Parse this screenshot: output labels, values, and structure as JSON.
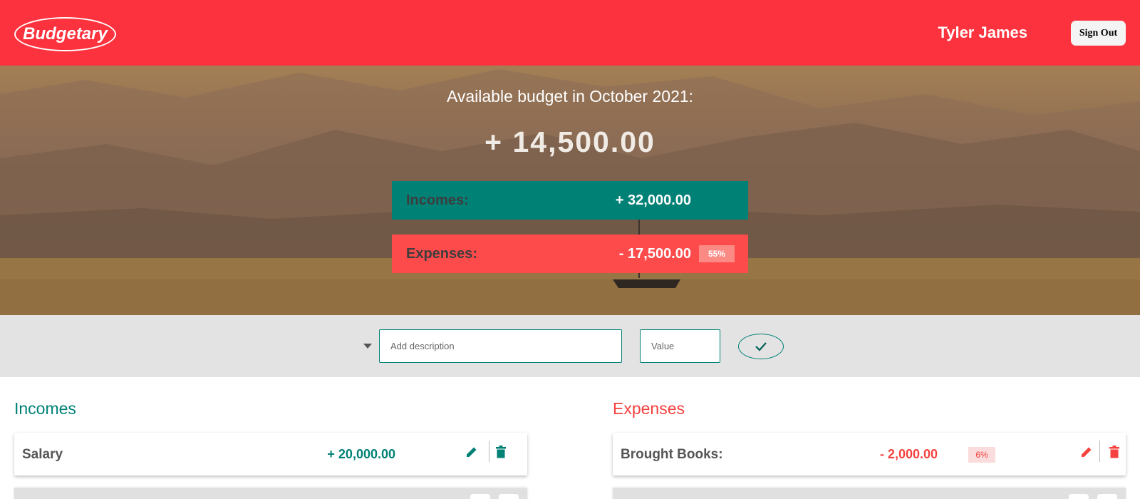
{
  "header": {
    "logo_text": "Budgetary",
    "user_name": "Tyler James",
    "signout_label": "Sign Out",
    "brand_color": "#fc333e"
  },
  "summary": {
    "title": "Available budget in October 2021:",
    "budget_value": "+ 14,500.00",
    "incomes_label": "Incomes:",
    "incomes_value": "+ 32,000.00",
    "expenses_label": "Expenses:",
    "expenses_value": "- 17,500.00",
    "expenses_percent": "55%"
  },
  "add_form": {
    "type_select_icon": "caret-down-icon",
    "description_placeholder": "Add description",
    "description_value": "",
    "value_placeholder": "Value",
    "value_value": "",
    "submit_icon": "checkmark-icon"
  },
  "incomes": {
    "title": "Incomes",
    "color": "#008176",
    "items": [
      {
        "description": "Salary",
        "value": "+ 20,000.00",
        "edit_icon": "pencil-icon",
        "delete_icon": "trash-icon"
      }
    ]
  },
  "expenses": {
    "title": "Expenses",
    "color": "#f4423f",
    "items": [
      {
        "description": "Brought Books:",
        "value": "- 2,000.00",
        "percent": "6%",
        "edit_icon": "pencil-icon",
        "delete_icon": "trash-icon"
      }
    ]
  }
}
